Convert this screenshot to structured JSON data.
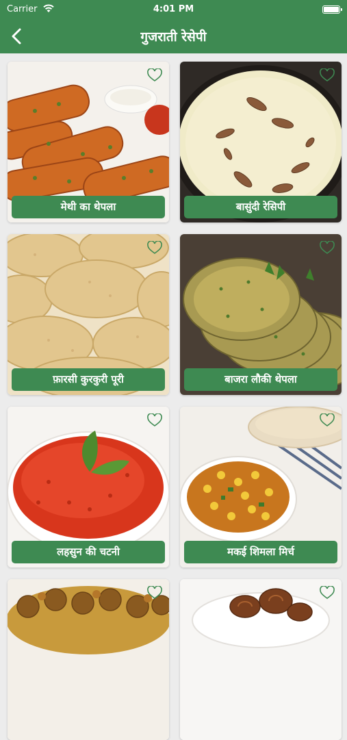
{
  "status": {
    "carrier": "Carrier",
    "time": "4:01 PM"
  },
  "nav": {
    "title": "गुजराती रेसेपी"
  },
  "theme": {
    "accent": "#3e8a52"
  },
  "recipes": [
    {
      "label": "मेथी का थेपला",
      "photo": "thepla-photo",
      "favorite": false
    },
    {
      "label": "बासुंदी रेसिपी",
      "photo": "basundi-photo",
      "favorite": false
    },
    {
      "label": "फ़ारसी कुरकुरी पूरी",
      "photo": "farsi-puri-photo",
      "favorite": false
    },
    {
      "label": "बाजरा लौकी थेपला",
      "photo": "bajra-thepla-photo",
      "favorite": false
    },
    {
      "label": "लहसुन की चटनी",
      "photo": "garlic-chutney-photo",
      "favorite": false
    },
    {
      "label": "मकई शिमला मिर्च",
      "photo": "corn-capsicum-photo",
      "favorite": false
    },
    {
      "label": "",
      "photo": "stuffed-veg-photo",
      "favorite": false
    },
    {
      "label": "",
      "photo": "rolls-photo",
      "favorite": false
    }
  ]
}
